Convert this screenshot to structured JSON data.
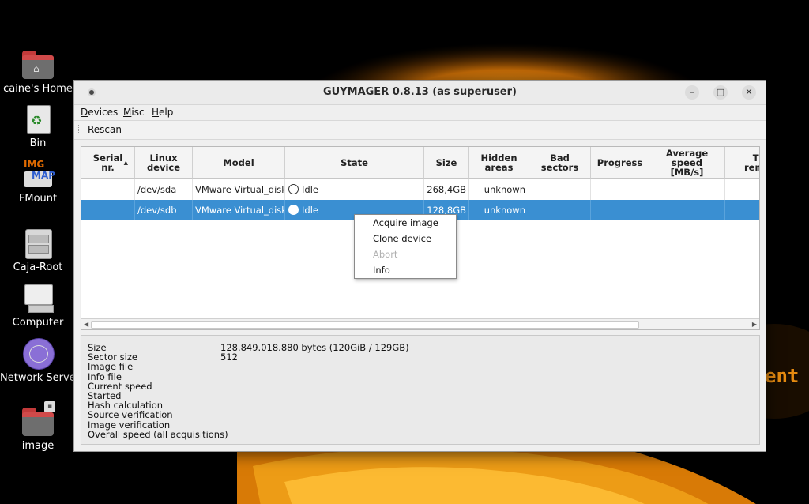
{
  "window": {
    "title": "GUYMAGER 0.8.13 (as superuser)",
    "minimize_glyph": "–",
    "maximize_glyph": "□",
    "close_glyph": "✕"
  },
  "menu": [
    {
      "underline": "D",
      "rest": "evices"
    },
    {
      "underline": "M",
      "rest": "isc"
    },
    {
      "underline": "H",
      "rest": "elp"
    }
  ],
  "toolbar": {
    "rescan_label": "Rescan"
  },
  "table": {
    "columns": {
      "serial": [
        "Serial",
        "nr."
      ],
      "linux": [
        "Linux",
        "device"
      ],
      "model": "Model",
      "state": "State",
      "size": "Size",
      "hidden": [
        "Hidden",
        "areas"
      ],
      "bad": [
        "Bad",
        "sectors"
      ],
      "progress": "Progress",
      "speed": [
        "Average",
        "speed",
        "[MB/s]"
      ],
      "remaining": [
        "Ti",
        "rema"
      ]
    },
    "sort_indicator": "▲",
    "rows": [
      {
        "serial": "",
        "device": "/dev/sda",
        "model": "VMware Virtual_disk",
        "state": "Idle",
        "size": "268,4GB",
        "hidden": "unknown",
        "bad": "",
        "progress": "",
        "speed": "",
        "remaining": ""
      },
      {
        "serial": "",
        "device": "/dev/sdb",
        "model": "VMware Virtual_disk",
        "state": "Idle",
        "size": "128,8GB",
        "hidden": "unknown",
        "bad": "",
        "progress": "",
        "speed": "",
        "remaining": ""
      }
    ]
  },
  "context_menu": {
    "items": [
      "Acquire image",
      "Clone device",
      "Abort",
      "Info"
    ],
    "disabled": "Abort"
  },
  "info_panel": {
    "labels": [
      "Size",
      "Sector size",
      "Image file",
      "Info file",
      "Current speed",
      "Started",
      "Hash calculation",
      "Source verification",
      "Image verification",
      "Overall speed (all acquisitions)"
    ],
    "size_value": "128.849.018.880 bytes (120GiB / 129GB)",
    "sector_size_value": "512"
  },
  "desktop": {
    "icons": [
      "caine's Home",
      "Bin",
      "FMount",
      "Caja-Root",
      "Computer",
      "Network Server",
      "image"
    ],
    "fmount_badge_top": "IMG",
    "fmount_badge_bottom": "MAP",
    "background_text": "ent"
  },
  "colors": {
    "selection": "#3a8fd2",
    "background_orange": "#e58a10"
  }
}
